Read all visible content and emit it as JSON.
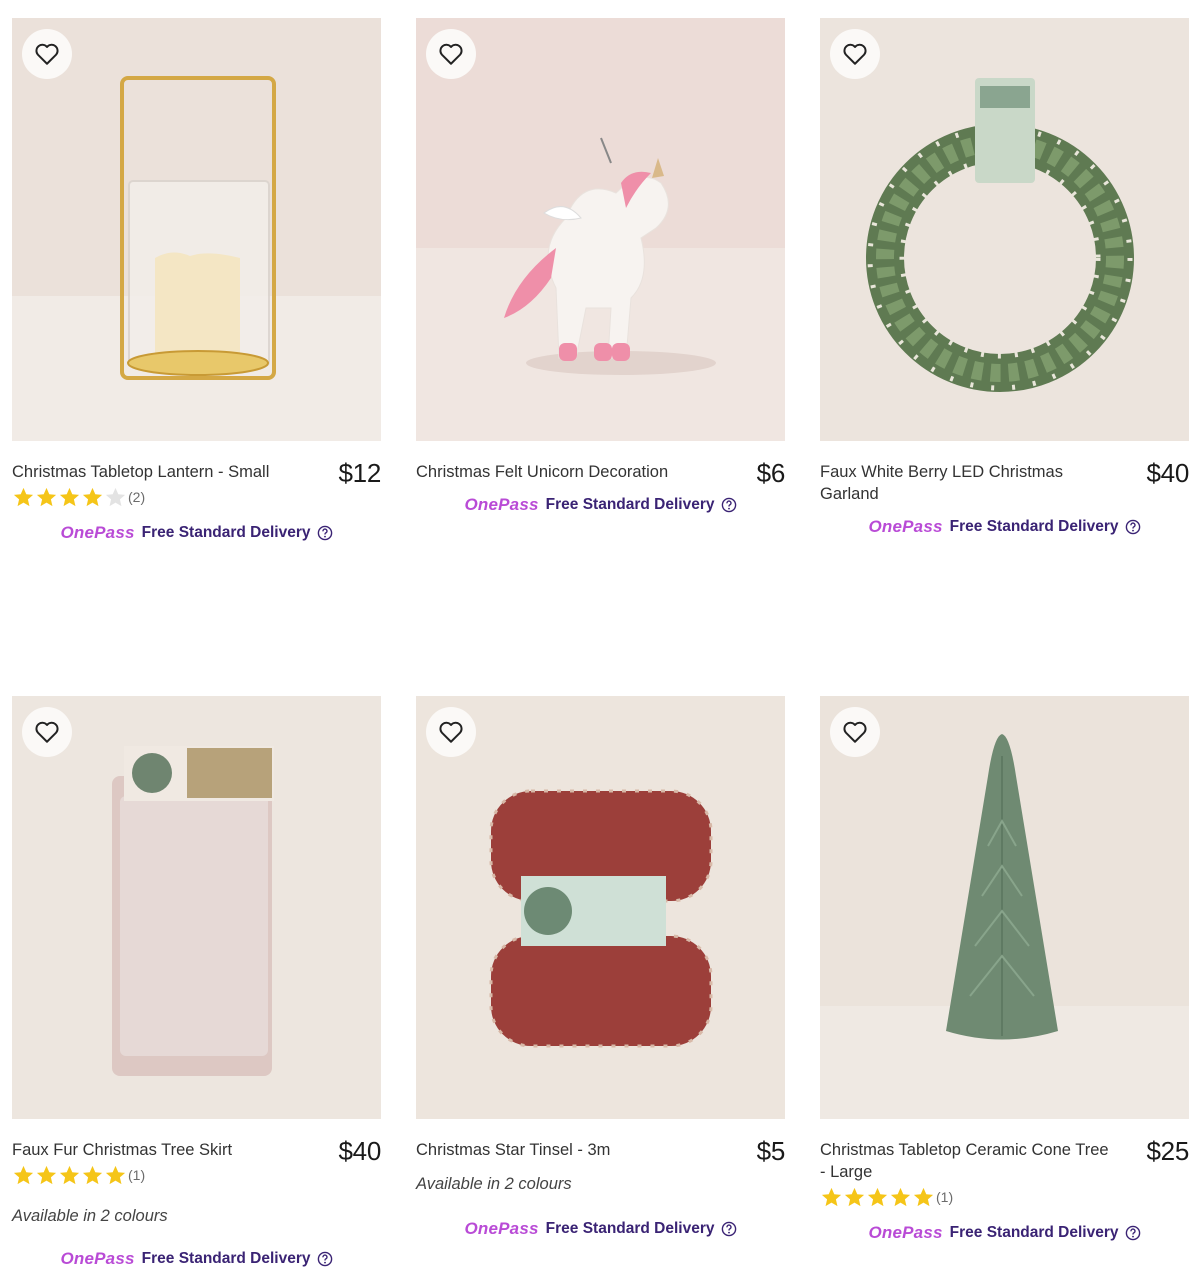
{
  "products": [
    {
      "title": "Christmas Tabletop Lantern - Small",
      "price": "$12",
      "rating": 4,
      "rating_count": "(2)",
      "colours": "",
      "onepass_logo": "OnePass",
      "delivery": "Free Standard Delivery",
      "icon": "lantern"
    },
    {
      "title": "Christmas Felt Unicorn Decoration",
      "price": "$6",
      "rating": null,
      "rating_count": "",
      "colours": "",
      "onepass_logo": "OnePass",
      "delivery": "Free Standard Delivery",
      "icon": "unicorn"
    },
    {
      "title": "Faux White Berry LED Christmas Garland",
      "price": "$40",
      "rating": null,
      "rating_count": "",
      "colours": "",
      "onepass_logo": "OnePass",
      "delivery": "Free Standard Delivery",
      "icon": "wreath"
    },
    {
      "title": "Faux Fur Christmas Tree Skirt",
      "price": "$40",
      "rating": 5,
      "rating_count": "(1)",
      "colours": "Available in 2 colours",
      "onepass_logo": "OnePass",
      "delivery": "Free Standard Delivery",
      "icon": "tree-skirt"
    },
    {
      "title": "Christmas Star Tinsel - 3m",
      "price": "$5",
      "rating": null,
      "rating_count": "",
      "colours": "Available in 2 colours",
      "onepass_logo": "OnePass",
      "delivery": "Free Standard Delivery",
      "icon": "tinsel"
    },
    {
      "title": "Christmas Tabletop Ceramic Cone Tree - Large",
      "price": "$25",
      "rating": 5,
      "rating_count": "(1)",
      "colours": "",
      "onepass_logo": "OnePass",
      "delivery": "Free Standard Delivery",
      "icon": "cone-tree"
    }
  ],
  "colors": {
    "star": "#f5c518",
    "star_empty": "#e3e3e3",
    "onepass_logo": "#b94bd6",
    "onepass_text": "#3a2374"
  }
}
